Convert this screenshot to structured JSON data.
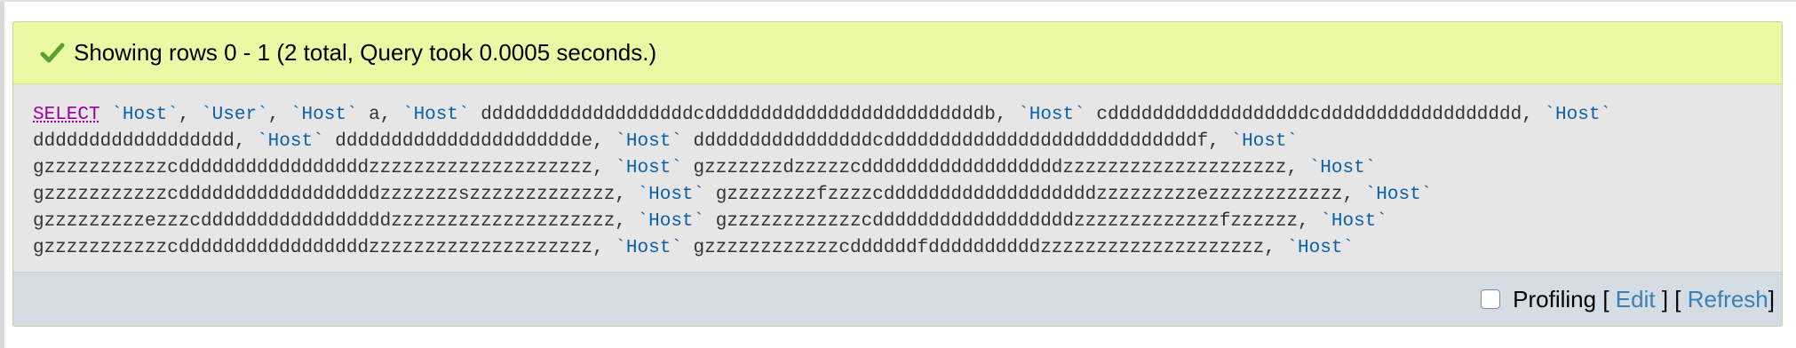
{
  "message": {
    "icon": "check-icon",
    "text": "Showing rows 0 - 1 (2 total, Query took 0.0005 seconds.)"
  },
  "sql": {
    "keyword": "SELECT",
    "id": "`Host`",
    "user": "`User`",
    "lines": [
      {
        "a": " ",
        "b": ", ",
        "c": ", ",
        "d": " a, ",
        "e": " dddddddddddddddddddcdddddddddddddddddddddddddb, ",
        "f": " cddddddddddddddddddcdddddddddddddddddd, "
      },
      {
        "a": "dddddddddddddddddd, ",
        "b": " dddddddddddddddddddddde, ",
        "c": " ddddddddddddddddcddddddddddddddddddddddddddddf, "
      },
      {
        "a": "gzzzzzzzzzzzcdddddddddddddddddzzzzzzzzzzzzzzzzzzzz, ",
        "b": " gzzzzzzzdzzzzzcddddddddddddddddddzzzzzzzzzzzzzzzzzzzz, "
      },
      {
        "a": "gzzzzzzzzzzzcddddddddddddddddddzzzzzzzszzzzzzzzzzzzz, ",
        "b": " gzzzzzzzzfzzzzcdddddddddddddddddddzzzzzzzzzezzzzzzzzzzzz, "
      },
      {
        "a": "gzzzzzzzzzezzzcdddddddddddddddddzzzzzzzzzzzzzzzzzzzz, ",
        "b": " gzzzzzzzzzzzzcddddddddddddddddddzzzzzzzzzzzzzfzzzzzz, "
      },
      {
        "a": "gzzzzzzzzzzzcdddddddddddddddddzzzzzzzzzzzzzzzzzzzz, ",
        "b": " gzzzzzzzzzzzzcddddddfddddddddddzzzzzzzzzzzzzzzzzzzz, "
      }
    ]
  },
  "profiling": {
    "label": "Profiling",
    "open": "[ ",
    "mid": " ] [ ",
    "close": "]",
    "edit": "Edit",
    "refresh": "Refresh"
  }
}
